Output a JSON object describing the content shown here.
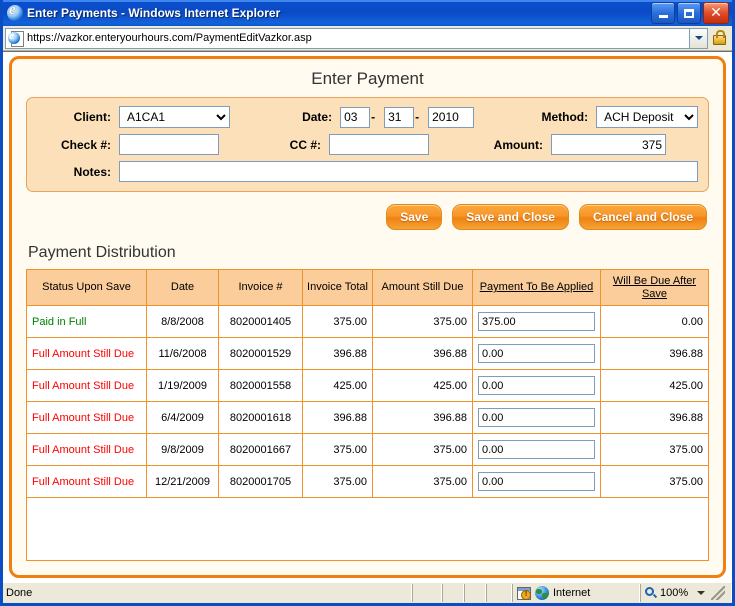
{
  "window": {
    "title": "Enter Payments - Windows Internet Explorer",
    "minimize_label": "–",
    "maximize_label": "",
    "close_label": "✕"
  },
  "address_bar": {
    "url": "https://vazkor.enteryourhours.com/PaymentEditVazkor.asp"
  },
  "page": {
    "title": "Enter Payment",
    "form": {
      "client_label": "Client:",
      "client_value": "A1CA1",
      "date_label": "Date:",
      "date_month": "03",
      "date_day": "31",
      "date_year": "2010",
      "date_sep": "-",
      "method_label": "Method:",
      "method_value": "ACH Deposit",
      "check_label": "Check #:",
      "check_value": "",
      "cc_label": "CC #:",
      "cc_value": "",
      "amount_label": "Amount:",
      "amount_value": "375",
      "notes_label": "Notes:",
      "notes_value": ""
    },
    "buttons": {
      "save": "Save",
      "save_and_close": "Save and Close",
      "cancel_and_close": "Cancel and Close"
    },
    "distribution": {
      "section_title": "Payment Distribution",
      "columns": [
        "Status Upon Save",
        "Date",
        "Invoice #",
        "Invoice Total",
        "Amount Still Due",
        "Payment To Be Applied",
        "Will Be Due After Save"
      ],
      "rows": [
        {
          "status": "Paid in Full",
          "status_state": "paid",
          "date": "8/8/2008",
          "invoice": "8020001405",
          "total": "375.00",
          "due": "375.00",
          "apply": "375.00",
          "after": "0.00"
        },
        {
          "status": "Full Amount Still Due",
          "status_state": "due",
          "date": "11/6/2008",
          "invoice": "8020001529",
          "total": "396.88",
          "due": "396.88",
          "apply": "0.00",
          "after": "396.88"
        },
        {
          "status": "Full Amount Still Due",
          "status_state": "due",
          "date": "1/19/2009",
          "invoice": "8020001558",
          "total": "425.00",
          "due": "425.00",
          "apply": "0.00",
          "after": "425.00"
        },
        {
          "status": "Full Amount Still Due",
          "status_state": "due",
          "date": "6/4/2009",
          "invoice": "8020001618",
          "total": "396.88",
          "due": "396.88",
          "apply": "0.00",
          "after": "396.88"
        },
        {
          "status": "Full Amount Still Due",
          "status_state": "due",
          "date": "9/8/2009",
          "invoice": "8020001667",
          "total": "375.00",
          "due": "375.00",
          "apply": "0.00",
          "after": "375.00"
        },
        {
          "status": "Full Amount Still Due",
          "status_state": "due",
          "date": "12/21/2009",
          "invoice": "8020001705",
          "total": "375.00",
          "due": "375.00",
          "apply": "0.00",
          "after": "375.00"
        }
      ]
    }
  },
  "status_bar": {
    "message": "Done",
    "zone": "Internet",
    "zoom": "100%"
  },
  "colors": {
    "accent_orange": "#F07F10",
    "panel_peach": "#FBE0B9",
    "header_peach": "#FBCD9B",
    "page_cream": "#FFFBF0",
    "status_paid": "#008000",
    "status_due": "#FF0000",
    "titlebar_blue": "#0A4DC4"
  }
}
